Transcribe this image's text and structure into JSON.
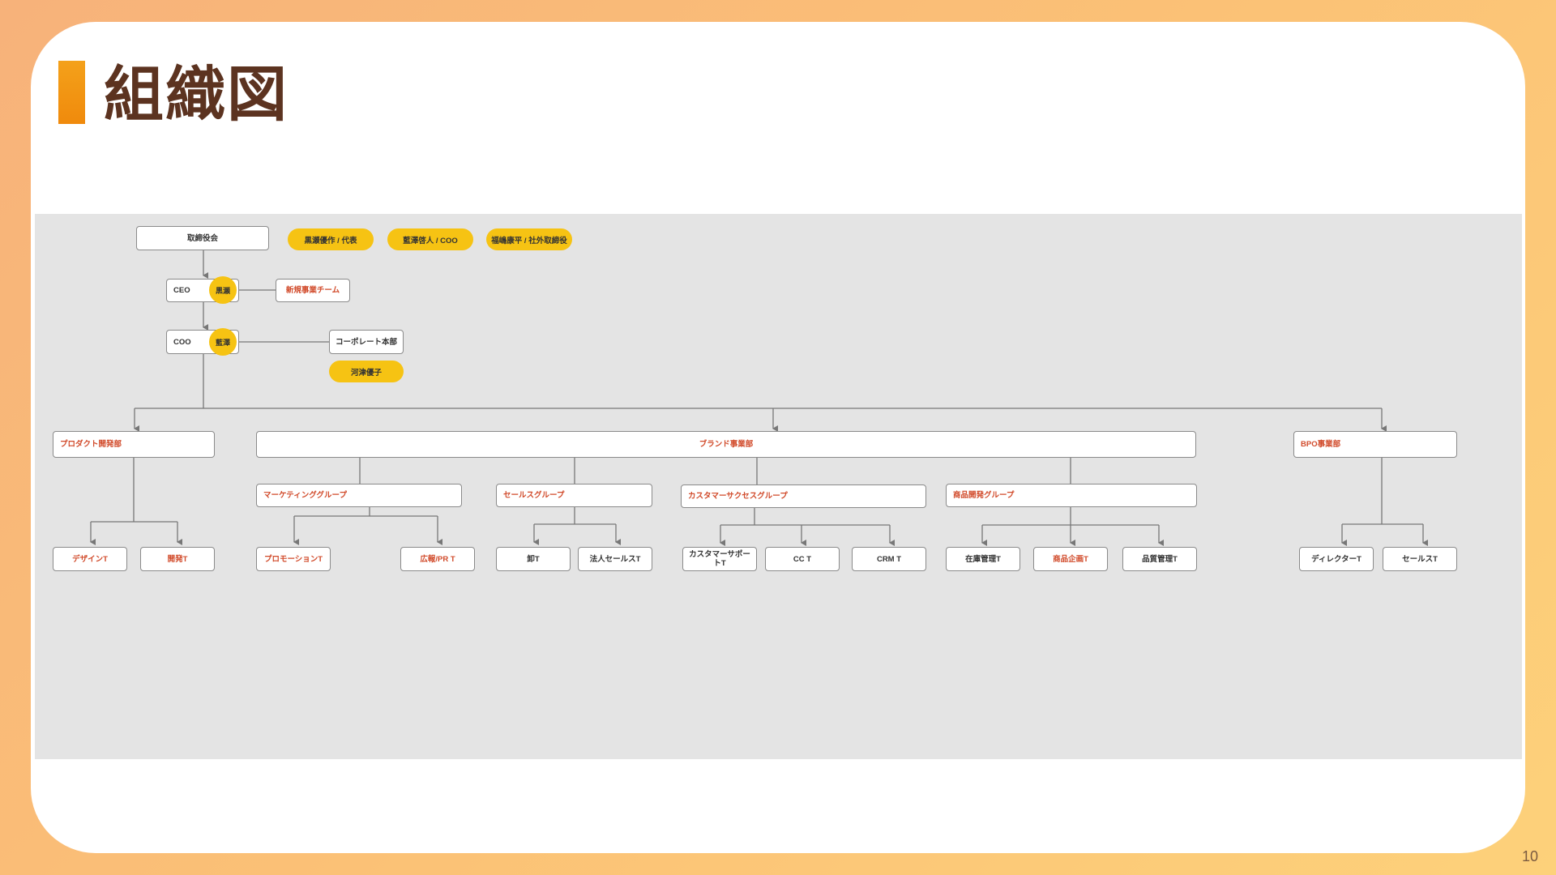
{
  "slide": {
    "title": "組織図",
    "page_number": "10"
  },
  "board": {
    "label": "取締役会",
    "members": [
      "黒瀬優作 / 代表",
      "藍澤啓人 / COO",
      "福嶋康平 / 社外取締役"
    ]
  },
  "ceo": {
    "role": "CEO",
    "person": "黒瀬"
  },
  "new_business": "新規事業チーム",
  "coo": {
    "role": "COO",
    "person": "藍澤"
  },
  "corporate": {
    "label": "コーポレート本部",
    "person": "河津優子"
  },
  "departments": {
    "product": {
      "label": "プロダクト開発部",
      "teams": [
        "デザインT",
        "開発T"
      ]
    },
    "brand": {
      "label": "ブランド事業部",
      "groups": [
        {
          "label": "マーケティンググループ",
          "teams": [
            "プロモーションT",
            "広報/PR T"
          ]
        },
        {
          "label": "セールスグループ",
          "teams": [
            "卸T",
            "法人セールスT"
          ]
        },
        {
          "label": "カスタマーサクセスグループ",
          "teams": [
            "カスタマーサポートT",
            "CC T",
            "CRM T"
          ]
        },
        {
          "label": "商品開発グループ",
          "teams": [
            "在庫管理T",
            "商品企画T",
            "品質管理T"
          ]
        }
      ]
    },
    "bpo": {
      "label": "BPO事業部",
      "teams": [
        "ディレクターT",
        "セールスT"
      ]
    }
  },
  "colors": {
    "accent_orange": "#f08a0c",
    "title_brown": "#5c3320",
    "pill_yellow": "#f6c313",
    "label_red": "#d14a2a",
    "panel_gray": "#e4e4e4"
  }
}
